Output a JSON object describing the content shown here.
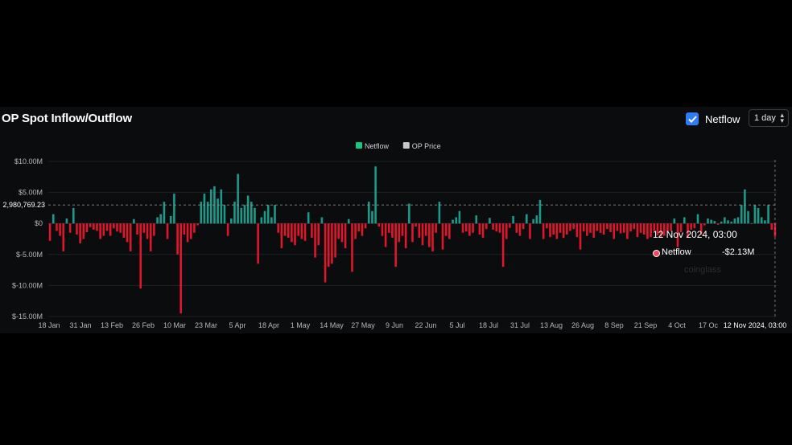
{
  "title": "OP Spot Inflow/Outflow",
  "controls": {
    "netflow_toggle_label": "Netflow",
    "netflow_checked": true,
    "interval_value": "1 day"
  },
  "colors": {
    "background": "#0b0c0e",
    "positive": "#1a9b8a",
    "negative": "#e0162b",
    "text": "#ffffff",
    "axis_text": "#b7b7b7",
    "grid": "#1f2125",
    "accent": "#2f7df6"
  },
  "tooltip": {
    "date": "12 Nov 2024, 03:00",
    "series": "Netflow",
    "value": "-$2.13M"
  },
  "crosshair_label": "2,980,769.23",
  "watermark": "coinglass",
  "chart_data": {
    "type": "bar",
    "title": "OP Spot Inflow/Outflow",
    "legend": [
      {
        "name": "Netflow",
        "color": "#16c784"
      },
      {
        "name": "OP Price",
        "color": "#c8c8c8"
      }
    ],
    "legend_position": "top-center",
    "y_ticks": [
      10000000,
      5000000,
      0,
      -5000000,
      -10000000,
      -15000000
    ],
    "y_tick_labels": [
      "$10.00M",
      "$5.00M",
      "$0",
      "$-5.00M",
      "$-10.00M",
      "$-15.00M"
    ],
    "ylim": [
      -15000000,
      10000000
    ],
    "x_tick_labels": [
      "18 Jan",
      "31 Jan",
      "13 Feb",
      "26 Feb",
      "10 Mar",
      "23 Mar",
      "5 Apr",
      "18 Apr",
      "1 May",
      "14 May",
      "27 May",
      "9 Jun",
      "22 Jun",
      "5 Jul",
      "18 Jul",
      "31 Jul",
      "13 Aug",
      "26 Aug",
      "8 Sep",
      "21 Sep",
      "4 Oct",
      "17 Oc",
      "12 Nov 2024, 03:00"
    ],
    "x_start": "2024-01-18",
    "x_unit": "day",
    "grid": true,
    "series": [
      {
        "name": "Netflow",
        "unit": "USD millions",
        "values": [
          -2.8,
          1.5,
          -1.2,
          -2,
          -4.5,
          0.8,
          -1.5,
          2.5,
          -1.8,
          -3.2,
          -2.5,
          -1.4,
          -0.6,
          -1,
          -1.2,
          -2.5,
          -2,
          -1.2,
          -2,
          -0.8,
          -1.3,
          -1.5,
          -2.3,
          -3,
          -4.5,
          0.7,
          -1.8,
          -10.5,
          -1.5,
          -2.5,
          -4.5,
          -2,
          1,
          1.5,
          3.5,
          -2.5,
          1.2,
          4.8,
          -5,
          -14.5,
          -1.8,
          -3,
          -2.5,
          -1.5,
          -0.3,
          3.5,
          4.8,
          3.5,
          5.5,
          6,
          4,
          5.5,
          3,
          -2,
          0.8,
          3.5,
          8,
          2.5,
          3,
          4.5,
          3.5,
          2.5,
          -6.5,
          1,
          2,
          3,
          1,
          3,
          -1.5,
          -4,
          -2,
          -2.3,
          -3,
          -3.5,
          -2,
          -2.5,
          -2.8,
          1.8,
          -2.3,
          -5.5,
          -3.5,
          1,
          -9.5,
          -7,
          -6.5,
          -5.5,
          -2.5,
          -3,
          -4,
          0.7,
          -7.8,
          -2.5,
          -1.3,
          -2,
          -0.8,
          3.5,
          2,
          9.2,
          -0.5,
          -2,
          -3.8,
          -1.5,
          -2.3,
          -7,
          -3,
          -2,
          -4,
          3.2,
          -3,
          -0.5,
          -2.3,
          -3.5,
          -2,
          -3.8,
          -4.5,
          -1.5,
          3.5,
          -4.2,
          -2,
          -2.5,
          0.6,
          1,
          2,
          -1.5,
          -1.3,
          -2,
          -1.5,
          1.3,
          -1.8,
          -2.3,
          -0.9,
          0.9,
          -1,
          -1.3,
          -1.5,
          -7,
          -2.5,
          -0.7,
          1.2,
          -1.5,
          -2,
          -0.9,
          1.5,
          -2.5,
          0.7,
          1.3,
          3.8,
          -2.5,
          -0.8,
          -2.2,
          -1.8,
          -2.5,
          -1.5,
          -2.3,
          -1.8,
          -1.2,
          -0.9,
          -2.2,
          -4.2,
          -1.3,
          -2,
          -1.5,
          -2.3,
          -1.2,
          -1.5,
          -1.8,
          -0.9,
          -1.4,
          -2.5,
          -1.2,
          -1.6,
          -1.5,
          -2.5,
          -1.3,
          -0.9,
          -2.2,
          -1.5,
          -1.8,
          -2.5,
          -2.2,
          -1.2,
          -1.9,
          -2.3,
          -2,
          -1.3,
          -1.2,
          0.8,
          -3.8,
          -1.4,
          1,
          -2.2,
          -1,
          -0.8,
          1.5,
          -1.8,
          -0.3,
          0.8,
          0.6,
          0.4,
          -0.2,
          0.3,
          1,
          0.5,
          0.3,
          0.8,
          1,
          3,
          5.5,
          2,
          0,
          3,
          2.5,
          1,
          0.5,
          3,
          -1,
          -2.13
        ]
      },
      {
        "name": "OP Price",
        "values": []
      }
    ]
  }
}
